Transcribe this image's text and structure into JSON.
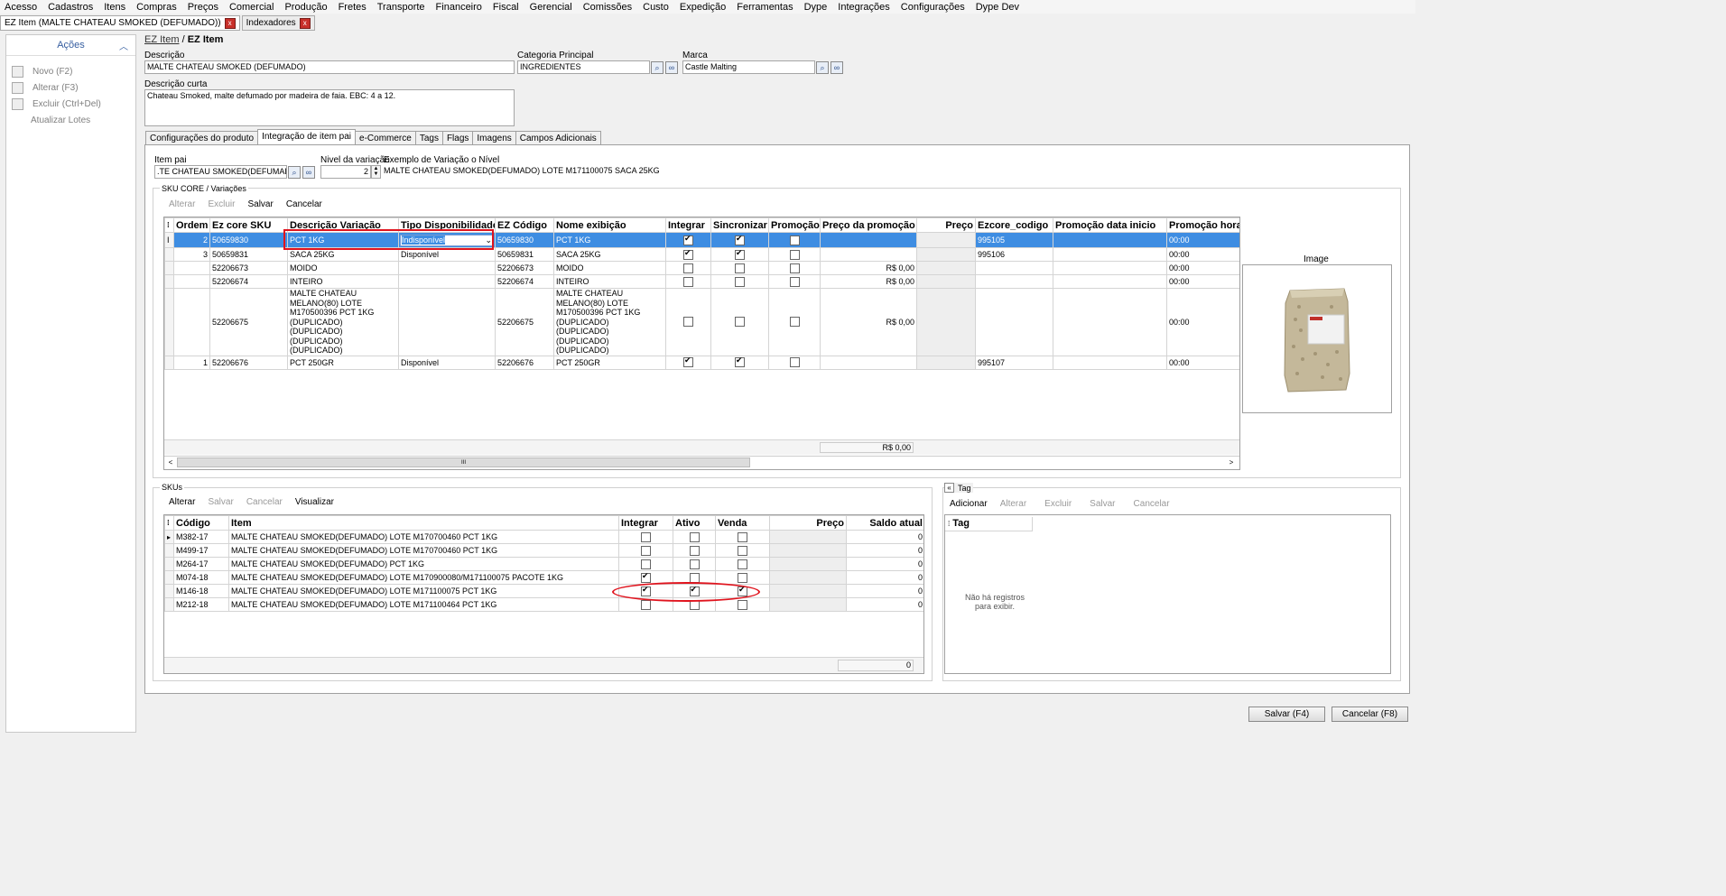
{
  "menu": [
    "Acesso",
    "Cadastros",
    "Itens",
    "Compras",
    "Preços",
    "Comercial",
    "Produção",
    "Fretes",
    "Transporte",
    "Financeiro",
    "Fiscal",
    "Gerencial",
    "Comissões",
    "Custo",
    "Expedição",
    "Ferramentas",
    "Dype",
    "Integrações",
    "Configurações",
    "Dype Dev"
  ],
  "doc_tabs": [
    {
      "label": "EZ Item (MALTE CHATEAU SMOKED (DEFUMADO))",
      "close": "x"
    },
    {
      "label": "Indexadores",
      "close": "x"
    }
  ],
  "sidebar": {
    "title": "Ações",
    "items": [
      "Novo (F2)",
      "Alterar (F3)",
      "Excluir (Ctrl+Del)",
      "Atualizar Lotes"
    ]
  },
  "breadcrumb": {
    "link": "EZ Item",
    "sep": "/",
    "current": "EZ Item"
  },
  "form": {
    "descricao_label": "Descrição",
    "descricao": "MALTE CHATEAU SMOKED (DEFUMADO)",
    "categoria_label": "Categoria Principal",
    "categoria": "INGREDIENTES",
    "marca_label": "Marca",
    "marca": "Castle Malting",
    "descricao_curta_label": "Descrição curta",
    "descricao_curta": "Chateau Smoked, malte defumado por madeira de faia. EBC: 4 a 12."
  },
  "tabs": [
    "Configurações do produto",
    "Integração de item pai",
    "e-Commerce",
    "Tags",
    "Flags",
    "Imagens",
    "Campos Adicionais"
  ],
  "item_pai": {
    "label": "Item pai",
    "value": ".TE CHATEAU SMOKED(DEFUMADO)",
    "nivel_label": "Nivel da variação",
    "nivel_value": "2",
    "exemplo_label": "Exemplo de Variação o Nível",
    "exemplo_value": "MALTE CHATEAU SMOKED(DEFUMADO) LOTE M171100075 SACA 25KG"
  },
  "sku_core": {
    "title": "SKU CORE / Variações",
    "toolbar": [
      "Alterar",
      "Excluir",
      "Salvar",
      "Cancelar"
    ],
    "columns": [
      "Ordem",
      "Ez core SKU",
      "Descrição Variação",
      "Tipo Disponibilidade",
      "EZ Código",
      "Nome exibição",
      "Integrar",
      "Sincronizar",
      "Promoção",
      "Preço da promoção",
      "Preço",
      "Ezcore_codigo",
      "Promoção data inicio",
      "Promoção hora"
    ],
    "rows": [
      {
        "ordem": "2",
        "sku": "50659830",
        "desc": "PCT 1KG",
        "tipo": "Indisponível",
        "ez": "50659830",
        "nome": "PCT 1KG",
        "integrar": true,
        "sinc": true,
        "promo": false,
        "preco_promo": "",
        "ezcore": "995105",
        "hora": "00:00"
      },
      {
        "ordem": "3",
        "sku": "50659831",
        "desc": "SACA 25KG",
        "tipo": "Disponível",
        "ez": "50659831",
        "nome": "SACA 25KG",
        "integrar": true,
        "sinc": true,
        "promo": false,
        "preco_promo": "",
        "ezcore": "995106",
        "hora": "00:00"
      },
      {
        "ordem": "",
        "sku": "52206673",
        "desc": "MOIDO",
        "tipo": "",
        "ez": "52206673",
        "nome": "MOIDO",
        "integrar": false,
        "sinc": false,
        "promo": false,
        "preco_promo": "R$ 0,00",
        "ezcore": "",
        "hora": "00:00"
      },
      {
        "ordem": "",
        "sku": "52206674",
        "desc": "INTEIRO",
        "tipo": "",
        "ez": "52206674",
        "nome": "INTEIRO",
        "integrar": false,
        "sinc": false,
        "promo": false,
        "preco_promo": "R$ 0,00",
        "ezcore": "",
        "hora": "00:00"
      },
      {
        "ordem": "",
        "sku": "52206675",
        "desc": "MALTE CHATEAU MELANO(80) LOTE M170500396 PCT 1KG (DUPLICADO) (DUPLICADO) (DUPLICADO) (DUPLICADO)",
        "tipo": "",
        "ez": "52206675",
        "nome": "MALTE CHATEAU MELANO(80) LOTE M170500396 PCT 1KG (DUPLICADO) (DUPLICADO) (DUPLICADO) (DUPLICADO)",
        "integrar": false,
        "sinc": false,
        "promo": false,
        "preco_promo": "R$ 0,00",
        "ezcore": "",
        "hora": "00:00"
      },
      {
        "ordem": "1",
        "sku": "52206676",
        "desc": "PCT 250GR",
        "tipo": "Disponível",
        "ez": "52206676",
        "nome": "PCT 250GR",
        "integrar": true,
        "sinc": true,
        "promo": false,
        "preco_promo": "",
        "ezcore": "995107",
        "hora": "00:00"
      }
    ],
    "footer_total": "R$ 0,00",
    "scroll_thumb": "III",
    "image_label": "Image"
  },
  "skus": {
    "title": "SKUs",
    "toolbar": [
      "Alterar",
      "Salvar",
      "Cancelar",
      "Visualizar"
    ],
    "columns": [
      "Código",
      "Item",
      "Integrar",
      "Ativo",
      "Venda",
      "Preço",
      "Saldo atual"
    ],
    "rows": [
      {
        "codigo": "M382-17",
        "item": "MALTE CHATEAU SMOKED(DEFUMADO) LOTE M170700460 PCT 1KG",
        "integrar": false,
        "ativo": false,
        "venda": false,
        "saldo": "0"
      },
      {
        "codigo": "M499-17",
        "item": "MALTE CHATEAU SMOKED(DEFUMADO) LOTE M170700460 PCT 1KG",
        "integrar": false,
        "ativo": false,
        "venda": false,
        "saldo": "0"
      },
      {
        "codigo": "M264-17",
        "item": "MALTE CHATEAU SMOKED(DEFUMADO) PCT 1KG",
        "integrar": false,
        "ativo": false,
        "venda": false,
        "saldo": "0"
      },
      {
        "codigo": "M074-18",
        "item": "MALTE CHATEAU SMOKED(DEFUMADO) LOTE M170900080/M171100075 PACOTE 1KG",
        "integrar": true,
        "ativo": false,
        "venda": false,
        "saldo": "0"
      },
      {
        "codigo": "M146-18",
        "item": "MALTE CHATEAU SMOKED(DEFUMADO) LOTE M171100075 PCT 1KG",
        "integrar": true,
        "ativo": true,
        "venda": true,
        "saldo": "0"
      },
      {
        "codigo": "M212-18",
        "item": "MALTE CHATEAU SMOKED(DEFUMADO) LOTE M171100464 PCT 1KG",
        "integrar": false,
        "ativo": false,
        "venda": false,
        "saldo": "0"
      }
    ],
    "footer_total": "0"
  },
  "tag": {
    "title": "Tag",
    "toolbar": [
      "Adicionar",
      "Alterar",
      "Excluir",
      "Salvar",
      "Cancelar"
    ],
    "column": "Tag",
    "empty_line1": "Não há registros",
    "empty_line2": "para exibir."
  },
  "buttons": {
    "save": "Salvar (F4)",
    "cancel": "Cancelar (F8)"
  }
}
